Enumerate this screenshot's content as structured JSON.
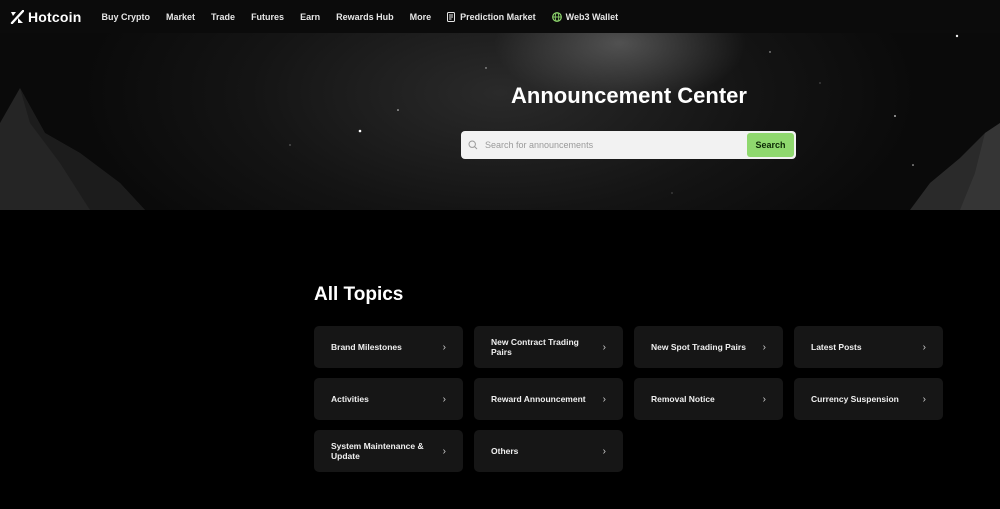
{
  "brand": {
    "name": "Hotcoin"
  },
  "nav": {
    "items": [
      {
        "label": "Buy Crypto"
      },
      {
        "label": "Market"
      },
      {
        "label": "Trade"
      },
      {
        "label": "Futures"
      },
      {
        "label": "Earn"
      },
      {
        "label": "Rewards Hub"
      },
      {
        "label": "More"
      },
      {
        "label": "Prediction Market",
        "icon": "document-icon"
      },
      {
        "label": "Web3 Wallet",
        "icon": "globe-icon"
      }
    ]
  },
  "hero": {
    "title": "Announcement Center",
    "search": {
      "placeholder": "Search for announcements",
      "value": "",
      "button_label": "Search",
      "button_color": "#8fd86e"
    }
  },
  "topics": {
    "title": "All Topics",
    "items": [
      {
        "label": "Brand Milestones"
      },
      {
        "label": "New Contract Trading Pairs"
      },
      {
        "label": "New Spot Trading Pairs"
      },
      {
        "label": "Latest Posts"
      },
      {
        "label": "Activities"
      },
      {
        "label": "Reward Announcement"
      },
      {
        "label": "Removal Notice"
      },
      {
        "label": "Currency Suspension"
      },
      {
        "label": "System Maintenance & Update"
      },
      {
        "label": "Others"
      }
    ],
    "chevron": "›"
  },
  "colors": {
    "background": "#000000",
    "card": "#161616",
    "accent": "#8fd86e"
  }
}
